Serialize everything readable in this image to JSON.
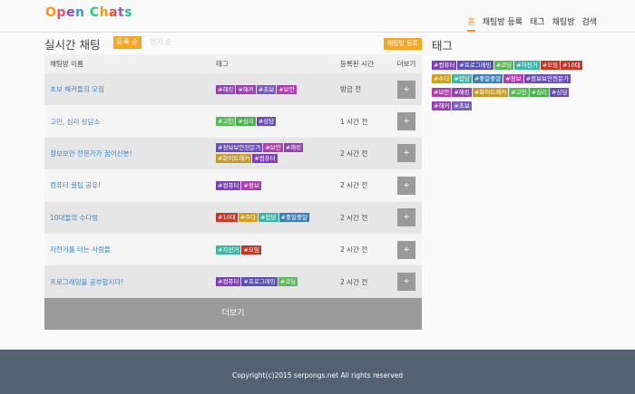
{
  "header": {
    "logo": [
      {
        "ch": "O",
        "color": "#f7941d"
      },
      {
        "ch": "p",
        "color": "#e94e77"
      },
      {
        "ch": "e",
        "color": "#8e44ad"
      },
      {
        "ch": "n",
        "color": "#3498db"
      },
      {
        "ch": " ",
        "color": "#333333"
      },
      {
        "ch": "C",
        "color": "#2ecc71"
      },
      {
        "ch": "h",
        "color": "#f39c12"
      },
      {
        "ch": "a",
        "color": "#e74c3c"
      },
      {
        "ch": "t",
        "color": "#9b59b6"
      },
      {
        "ch": "s",
        "color": "#1abc9c"
      }
    ],
    "nav": [
      "홈",
      "채팅방 등록",
      "태그",
      "채팅방",
      "검색"
    ]
  },
  "main": {
    "title": "실시간 채팅",
    "sort_registered": "등록 순",
    "sort_popular": "인기 순",
    "register_button": "채팅방 등록",
    "columns": {
      "name": "채팅방 이름",
      "tags": "태그",
      "time": "등록된 시간",
      "more": "더보기"
    },
    "more_icon": "+",
    "rows": [
      {
        "name": "초보 해커들의 모임",
        "tags": [
          {
            "label": "#해킹",
            "color": "#8e44ad"
          },
          {
            "label": "#해커",
            "color": "#9b3fb5"
          },
          {
            "label": "#초보",
            "color": "#7d5cc0"
          },
          {
            "label": "#보안",
            "color": "#b03fae"
          }
        ],
        "time": "방금 전"
      },
      {
        "name": "고민, 심리 상담소",
        "tags": [
          {
            "label": "#고민",
            "color": "#5cb85c"
          },
          {
            "label": "#심리",
            "color": "#4caf50"
          },
          {
            "label": "#상담",
            "color": "#6a4fb6"
          }
        ],
        "time": "1 시간 전"
      },
      {
        "name": "정보보안 전문가가 꿈이신분!",
        "tags": [
          {
            "label": "#정보보안전문가",
            "color": "#6a4fb6"
          },
          {
            "label": "#보안",
            "color": "#b03fae"
          },
          {
            "label": "#해킹",
            "color": "#8e44ad"
          },
          {
            "label": "#화이트해커",
            "color": "#c49a2a"
          },
          {
            "label": "#컴퓨터",
            "color": "#7d3fb5"
          }
        ],
        "time": "2 시간 전"
      },
      {
        "name": "컴퓨터 꿀팁 공유!",
        "tags": [
          {
            "label": "#컴퓨터",
            "color": "#7d3fb5"
          },
          {
            "label": "#정보",
            "color": "#b03fae"
          }
        ],
        "time": "2 시간 전"
      },
      {
        "name": "10대들의 수다방",
        "tags": [
          {
            "label": "#10대",
            "color": "#c0392b"
          },
          {
            "label": "#수다",
            "color": "#d4a017"
          },
          {
            "label": "#잡담",
            "color": "#3fb5a5"
          },
          {
            "label": "#좋알좋알",
            "color": "#3f7fb5"
          }
        ],
        "time": "2 시간 전"
      },
      {
        "name": "자전거를 타는 사람들",
        "tags": [
          {
            "label": "#자전거",
            "color": "#3fb5a5"
          },
          {
            "label": "#모임",
            "color": "#c0392b"
          }
        ],
        "time": "2 시간 전"
      },
      {
        "name": "프로그래밍을 공부합시다!",
        "tags": [
          {
            "label": "#컴퓨터",
            "color": "#7d3fb5"
          },
          {
            "label": "#프로그래밍",
            "color": "#5a4fb6"
          },
          {
            "label": "#코딩",
            "color": "#5cb85c"
          }
        ],
        "time": "2 시간 전"
      }
    ],
    "more_bar": "더보기"
  },
  "sidebar": {
    "title": "태그",
    "tags": [
      {
        "label": "#컴퓨터",
        "color": "#7d3fb5"
      },
      {
        "label": "#프로그래밍",
        "color": "#5a4fb6"
      },
      {
        "label": "#코딩",
        "color": "#5cb85c"
      },
      {
        "label": "#자전거",
        "color": "#3fb5a5"
      },
      {
        "label": "#모임",
        "color": "#c0392b"
      },
      {
        "label": "#10대",
        "color": "#c0392b"
      },
      {
        "label": "#수다",
        "color": "#d4a017"
      },
      {
        "label": "#잡담",
        "color": "#3fb5a5"
      },
      {
        "label": "#좋알좋알",
        "color": "#3f7fb5"
      },
      {
        "label": "#정보",
        "color": "#b03fae"
      },
      {
        "label": "#정보보안전문가",
        "color": "#6a4fb6"
      },
      {
        "label": "#보안",
        "color": "#b03fae"
      },
      {
        "label": "#해킹",
        "color": "#8e44ad"
      },
      {
        "label": "#화이트해커",
        "color": "#c49a2a"
      },
      {
        "label": "#고민",
        "color": "#5cb85c"
      },
      {
        "label": "#심리",
        "color": "#4caf50"
      },
      {
        "label": "#상담",
        "color": "#6a4fb6"
      },
      {
        "label": "#해커",
        "color": "#9b3fb5"
      },
      {
        "label": "#초보",
        "color": "#7d5cc0"
      }
    ]
  },
  "footer": {
    "copyright": "Copyright(c)2015 serpongs.net All rights reserved"
  }
}
